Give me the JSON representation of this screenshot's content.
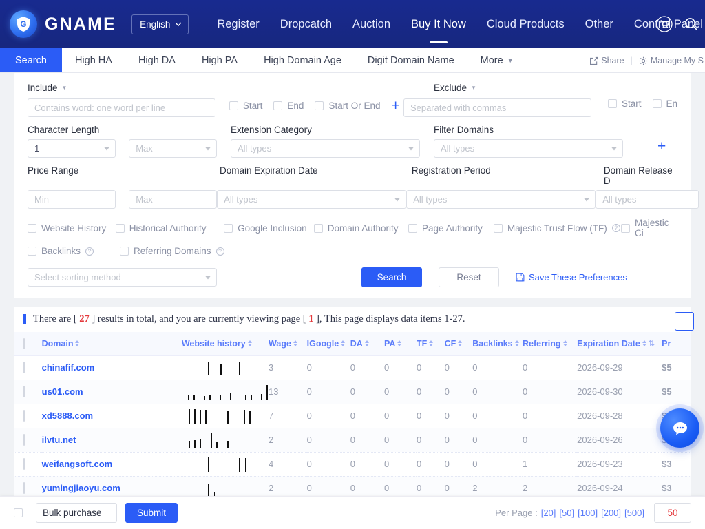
{
  "header": {
    "brand": "GNAME",
    "language": "English",
    "nav": [
      {
        "label": "Register",
        "active": false
      },
      {
        "label": "Dropcatch",
        "active": false
      },
      {
        "label": "Auction",
        "active": false
      },
      {
        "label": "Buy It Now",
        "active": true
      },
      {
        "label": "Cloud Products",
        "active": false
      },
      {
        "label": "Other",
        "active": false
      },
      {
        "label": "Control Panel",
        "active": false
      }
    ],
    "icons": [
      "cart-icon",
      "search-icon"
    ]
  },
  "tabs": [
    {
      "label": "Search",
      "primary": true
    },
    {
      "label": "High HA",
      "primary": false
    },
    {
      "label": "High DA",
      "primary": false
    },
    {
      "label": "High PA",
      "primary": false
    },
    {
      "label": "High Domain Age",
      "primary": false
    },
    {
      "label": "Digit Domain Name",
      "primary": false
    },
    {
      "label": "More",
      "primary": false
    }
  ],
  "tab_actions": {
    "share": "Share",
    "manage": "Manage My S"
  },
  "filters": {
    "include": {
      "label": "Include",
      "placeholder": "Contains word: one word per line",
      "checkboxes": [
        "Start",
        "End",
        "Start Or End"
      ]
    },
    "exclude": {
      "label": "Exclude",
      "placeholder": "Separated with commas",
      "checkboxes": [
        "Start",
        "En"
      ]
    },
    "character_length": {
      "label": "Character Length",
      "min": "1",
      "max": "Max"
    },
    "extension_category": {
      "label": "Extension Category",
      "value": "All types"
    },
    "filter_domains": {
      "label": "Filter Domains",
      "value": "All types"
    },
    "price_range": {
      "label": "Price Range",
      "min": "Min",
      "max": "Max"
    },
    "domain_expiration_date": {
      "label": "Domain Expiration Date",
      "value": "All types"
    },
    "registration_period": {
      "label": "Registration Period",
      "value": "All types"
    },
    "domain_release_date": {
      "label": "Domain Release D",
      "value": "All types"
    },
    "metric_checkboxes_row1": [
      {
        "label": "Website History",
        "help": false
      },
      {
        "label": "Historical Authority",
        "help": false
      },
      {
        "label": "Google Inclusion",
        "help": false
      },
      {
        "label": "Domain Authority",
        "help": false
      },
      {
        "label": "Page Authority",
        "help": false
      },
      {
        "label": "Majestic Trust Flow (TF)",
        "help": true
      },
      {
        "label": "Majestic Ci",
        "help": false
      }
    ],
    "metric_checkboxes_row2": [
      {
        "label": "Backlinks",
        "help": true
      },
      {
        "label": "Referring Domains",
        "help": true
      }
    ],
    "sorting": {
      "placeholder": "Select sorting method"
    },
    "search_button": "Search",
    "reset_button": "Reset",
    "save_preferences": "Save These Preferences"
  },
  "results": {
    "prefix": "There are [ ",
    "total": "27",
    "middle": " ] results in total, and you are currently viewing page [ ",
    "page": "1",
    "suffix": " ], This page displays data items 1-27."
  },
  "table": {
    "columns": [
      {
        "label": "Domain",
        "sortable": true
      },
      {
        "label": "Website history",
        "sortable": true
      },
      {
        "label": "Wage",
        "sortable": true
      },
      {
        "label": "IGoogle",
        "sortable": true
      },
      {
        "label": "DA",
        "sortable": true
      },
      {
        "label": "PA",
        "sortable": true
      },
      {
        "label": "TF",
        "sortable": true
      },
      {
        "label": "CF",
        "sortable": true
      },
      {
        "label": "Backlinks",
        "sortable": true
      },
      {
        "label": "Referring",
        "sortable": true
      },
      {
        "label": "Expiration Date",
        "sortable": true
      },
      {
        "label": "Pr",
        "sortable": false
      }
    ],
    "rows": [
      {
        "domain": "chinafif.com",
        "history": [
          0,
          0,
          0,
          0,
          85,
          0,
          70,
          0,
          0,
          90,
          0,
          0,
          0,
          0
        ],
        "wage": "3",
        "igoogle": "0",
        "da": "0",
        "pa": "0",
        "tf": "0",
        "cf": "0",
        "backlinks": "0",
        "referring": "0",
        "expiration": "2026-09-29",
        "price": "$5"
      },
      {
        "domain": "us01.com",
        "history": [
          0,
          30,
          25,
          0,
          22,
          24,
          0,
          30,
          0,
          45,
          0,
          0,
          28,
          26,
          0,
          35,
          95
        ],
        "wage": "13",
        "igoogle": "0",
        "da": "0",
        "pa": "0",
        "tf": "0",
        "cf": "0",
        "backlinks": "0",
        "referring": "0",
        "expiration": "2026-09-30",
        "price": "$5"
      },
      {
        "domain": "xd5888.com",
        "history": [
          0,
          95,
          92,
          90,
          88,
          0,
          0,
          0,
          85,
          0,
          0,
          88,
          86,
          0,
          0,
          0
        ],
        "wage": "7",
        "igoogle": "0",
        "da": "0",
        "pa": "0",
        "tf": "0",
        "cf": "0",
        "backlinks": "0",
        "referring": "0",
        "expiration": "2026-09-28",
        "price": "$3"
      },
      {
        "domain": "ilvtu.net",
        "history": [
          0,
          45,
          50,
          55,
          0,
          95,
          40,
          0,
          42,
          0,
          0,
          0,
          0,
          0,
          0,
          0
        ],
        "wage": "2",
        "igoogle": "0",
        "da": "0",
        "pa": "0",
        "tf": "0",
        "cf": "0",
        "backlinks": "0",
        "referring": "0",
        "expiration": "2026-09-26",
        "price": "$3"
      },
      {
        "domain": "weifangsoft.com",
        "history": [
          0,
          0,
          0,
          0,
          95,
          0,
          0,
          0,
          0,
          90,
          88,
          0,
          0,
          0
        ],
        "wage": "4",
        "igoogle": "0",
        "da": "0",
        "pa": "0",
        "tf": "0",
        "cf": "0",
        "backlinks": "0",
        "referring": "1",
        "expiration": "2026-09-23",
        "price": "$3"
      },
      {
        "domain": "yumingjiaoyu.com",
        "history": [
          0,
          0,
          0,
          0,
          80,
          20,
          0,
          0,
          0,
          0,
          0,
          0,
          0,
          0
        ],
        "wage": "2",
        "igoogle": "0",
        "da": "0",
        "pa": "0",
        "tf": "0",
        "cf": "0",
        "backlinks": "2",
        "referring": "2",
        "expiration": "2026-09-24",
        "price": "$3"
      }
    ]
  },
  "bottom": {
    "bulk_action": "Bulk purchase",
    "submit": "Submit",
    "per_page_label": "Per Page :",
    "per_page_options": [
      "20",
      "50",
      "100",
      "200",
      "500"
    ],
    "per_page_value": "50"
  }
}
